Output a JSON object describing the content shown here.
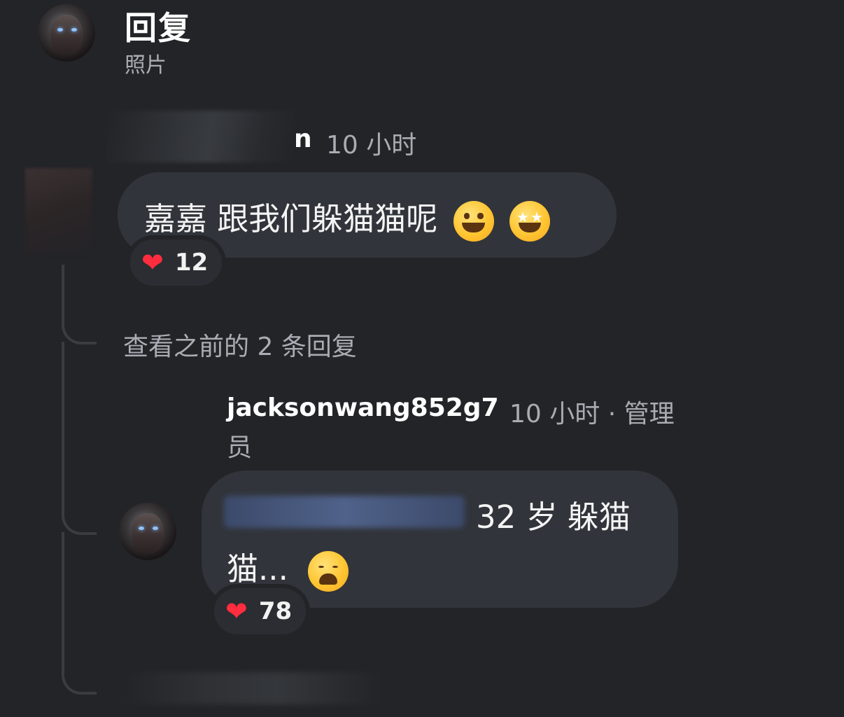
{
  "header": {
    "title": "回复",
    "subtitle": "照片"
  },
  "comment": {
    "author_visible_tail": "n",
    "time": "10 小时",
    "text": "嘉嘉 跟我们躲猫猫呢",
    "emojis": [
      "grinning-face-emoji",
      "star-struck-emoji"
    ],
    "reaction": {
      "icon": "red-heart",
      "count": "12"
    }
  },
  "thread": {
    "view_previous": "查看之前的 2 条回复"
  },
  "reply": {
    "author": "jacksonwang852g7",
    "meta_line1": "10 小时 · 管理",
    "meta_line2": "员",
    "text_line1": "32 岁 躲猫",
    "text_line2": "猫...",
    "emoji": "weary-face-emoji",
    "reaction": {
      "icon": "red-heart",
      "count": "78"
    }
  },
  "colors": {
    "background": "#232428",
    "bubble": "#31343a",
    "muted_text": "#a9acb2",
    "heart": "#ff2d3d"
  }
}
